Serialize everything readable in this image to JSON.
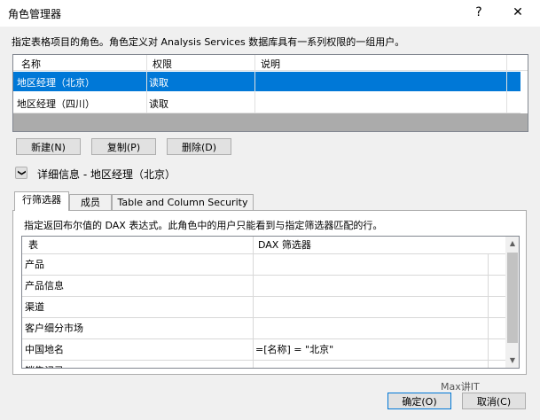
{
  "window": {
    "title": "角色管理器",
    "help_glyph": "?",
    "close_glyph": "✕"
  },
  "description": "指定表格项目的角色。角色定义对 Analysis Services 数据库具有一系列权限的一组用户。",
  "roles_table": {
    "columns": [
      "名称",
      "权限",
      "说明"
    ],
    "rows": [
      {
        "name": "地区经理（北京）",
        "permission": "读取",
        "description": ""
      },
      {
        "name": "地区经理（四川）",
        "permission": "读取",
        "description": ""
      }
    ]
  },
  "buttons": {
    "new": "新建(N)",
    "copy": "复制(P)",
    "delete": "删除(D)",
    "ok": "确定(O)",
    "cancel": "取消(C)"
  },
  "details": {
    "expander_glyph": "❯",
    "label": "详细信息 - 地区经理（北京）"
  },
  "tabs": [
    "行筛选器",
    "成员",
    "Table and Column Security"
  ],
  "row_filters": {
    "description": "指定返回布尔值的 DAX 表达式。此角色中的用户只能看到与指定筛选器匹配的行。",
    "columns": [
      "表",
      "DAX 筛选器"
    ],
    "rows": [
      {
        "table": "产品",
        "filter": ""
      },
      {
        "table": "产品信息",
        "filter": ""
      },
      {
        "table": "渠道",
        "filter": ""
      },
      {
        "table": "客户细分市场",
        "filter": ""
      },
      {
        "table": "中国地名",
        "filter": "=[名称] = \"北京\""
      },
      {
        "table": "销售记录",
        "filter": ""
      }
    ]
  },
  "watermark": "Max讲IT"
}
